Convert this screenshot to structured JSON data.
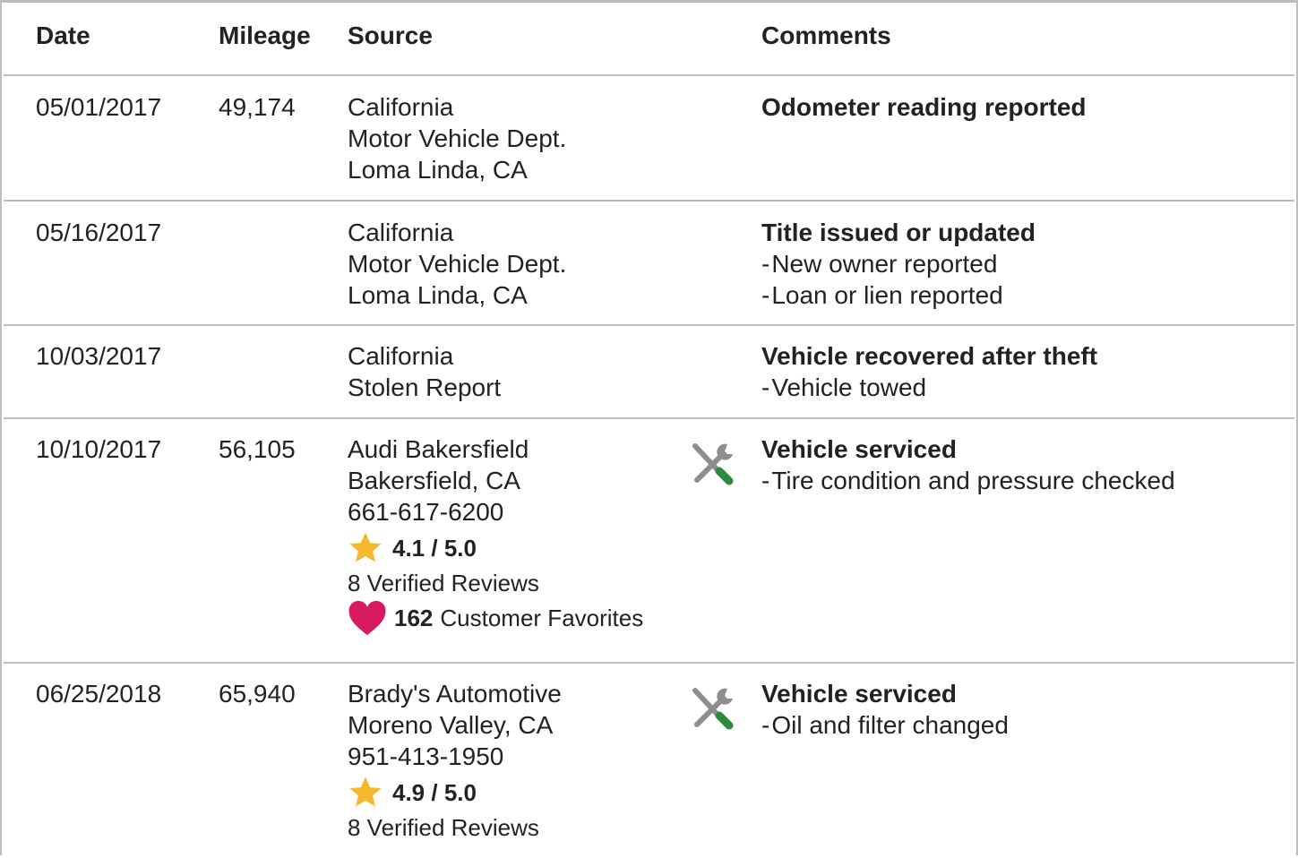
{
  "header": {
    "date": "Date",
    "mileage": "Mileage",
    "source": "Source",
    "comments": "Comments"
  },
  "rows": [
    {
      "date": "05/01/2017",
      "mileage": "49,174",
      "source": [
        "California",
        "Motor Vehicle Dept.",
        "Loma Linda, CA"
      ],
      "title": "Odometer reading reported",
      "details": []
    },
    {
      "date": "05/16/2017",
      "mileage": "",
      "source": [
        "California",
        "Motor Vehicle Dept.",
        "Loma Linda, CA"
      ],
      "title": "Title issued or updated",
      "details": [
        "New owner reported",
        "Loan or lien reported"
      ]
    },
    {
      "date": "10/03/2017",
      "mileage": "",
      "source": [
        "California",
        "Stolen Report"
      ],
      "title": "Vehicle recovered after theft",
      "details": [
        "Vehicle towed"
      ]
    },
    {
      "date": "10/10/2017",
      "mileage": "56,105",
      "source": [
        "Audi Bakersfield",
        "Bakersfield, CA",
        "661-617-6200"
      ],
      "rating": "4.1 / 5.0",
      "reviews": "8 Verified Reviews",
      "favorites_count": "162",
      "favorites_label": "Customer Favorites",
      "icon": "wrench-screwdriver-icon",
      "title": "Vehicle serviced",
      "details": [
        "Tire condition and pressure checked"
      ]
    },
    {
      "date": "06/25/2018",
      "mileage": "65,940",
      "source": [
        "Brady's Automotive",
        "Moreno Valley, CA",
        "951-413-1950"
      ],
      "rating": "4.9 / 5.0",
      "reviews": "8 Verified Reviews",
      "icon": "wrench-screwdriver-icon",
      "title": "Vehicle serviced",
      "details": [
        "Oil and filter changed"
      ]
    }
  ],
  "dash": "-",
  "colors": {
    "border": "#bdbdbd",
    "star": "#f5b82e",
    "heart": "#d81b60",
    "tool_gray": "#8e8e8e",
    "tool_green": "#2e8b3e"
  }
}
